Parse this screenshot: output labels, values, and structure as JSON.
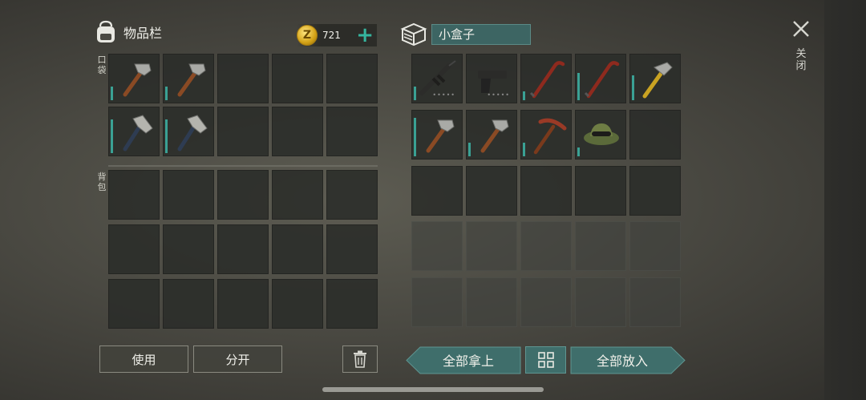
{
  "inventory": {
    "title": "物品栏",
    "coins": "721",
    "coin_symbol": "Z",
    "pocket_label": "口袋",
    "backpack_label": "背包",
    "pocket_items": [
      {
        "icon": "hammer-icon",
        "fill": 0.3
      },
      {
        "icon": "hammer-icon",
        "fill": 0.3
      },
      {
        "icon": "",
        "fill": 0
      },
      {
        "icon": "",
        "fill": 0
      },
      {
        "icon": "",
        "fill": 0
      },
      {
        "icon": "hatchet-icon",
        "fill": 0.75
      },
      {
        "icon": "hatchet-icon",
        "fill": 0.75
      },
      {
        "icon": "",
        "fill": 0
      },
      {
        "icon": "",
        "fill": 0
      },
      {
        "icon": "",
        "fill": 0
      }
    ]
  },
  "box": {
    "name": "小盒子",
    "items": [
      {
        "icon": "rifle-icon",
        "fill": 0.3,
        "ammo": true
      },
      {
        "icon": "pistol-icon",
        "fill": 0,
        "ammo": true
      },
      {
        "icon": "crowbar-icon",
        "fill": 0.2
      },
      {
        "icon": "crowbar-icon",
        "fill": 0.6
      },
      {
        "icon": "claw-hammer-icon",
        "fill": 0.55
      },
      {
        "icon": "hammer-icon",
        "fill": 0.85
      },
      {
        "icon": "hammer-icon",
        "fill": 0.3
      },
      {
        "icon": "pickaxe-icon",
        "fill": 0.3
      },
      {
        "icon": "hat-icon",
        "fill": 0.2
      },
      {
        "icon": "",
        "fill": 0
      }
    ]
  },
  "actions": {
    "use": "使用",
    "split": "分开",
    "take_all": "全部拿上",
    "put_all": "全部放入",
    "close": "关闭"
  },
  "colors": {
    "accent": "#3aa194",
    "teal_button": "#3f6e6b"
  }
}
